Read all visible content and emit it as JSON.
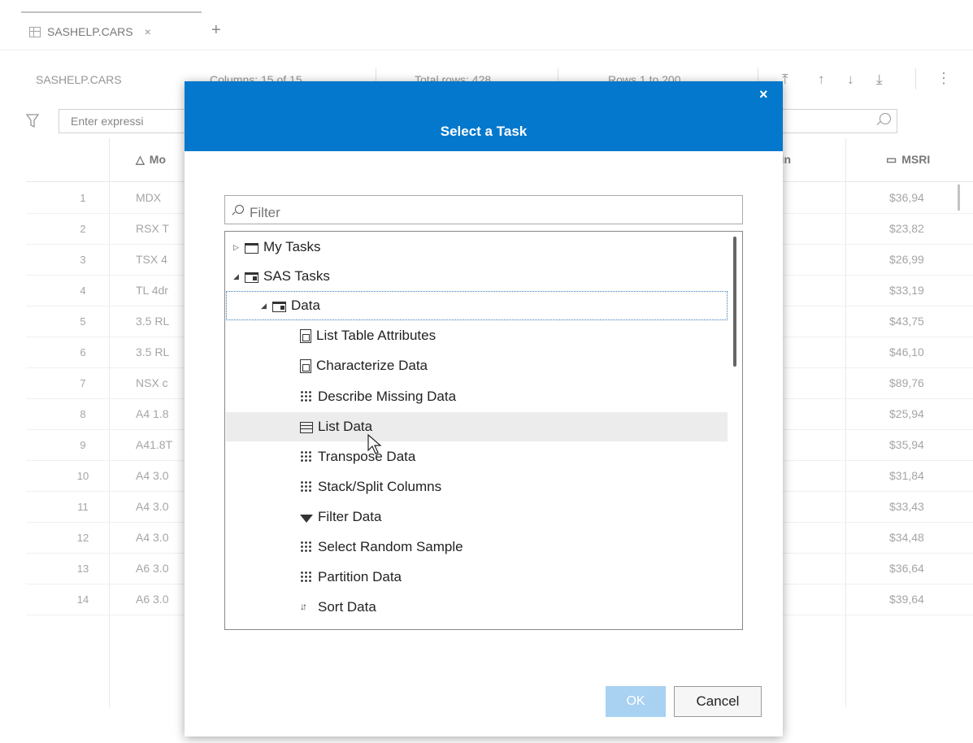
{
  "tab": {
    "title": "SASHELP.CARS",
    "close": "×",
    "add": "+"
  },
  "infobar": {
    "dataset": "SASHELP.CARS",
    "columns": "Columns: 15 of 15",
    "total_rows": "Total rows: 428",
    "rows_range": "Rows 1 to 200",
    "nav_icons": [
      "move-first-icon",
      "move-up-icon",
      "move-down-icon",
      "move-last-icon"
    ],
    "more": "⋮"
  },
  "expression": {
    "placeholder": "Enter expressi"
  },
  "grid": {
    "headers": {
      "model": "Mo",
      "origin": "gin",
      "msrp": "MSRI"
    },
    "rows": [
      {
        "n": "1",
        "model": "MDX",
        "msrp": "$36,94"
      },
      {
        "n": "2",
        "model": "RSX T",
        "msrp": "$23,82"
      },
      {
        "n": "3",
        "model": "TSX 4",
        "msrp": "$26,99"
      },
      {
        "n": "4",
        "model": "TL 4dr",
        "msrp": "$33,19"
      },
      {
        "n": "5",
        "model": "3.5 RL",
        "msrp": "$43,75"
      },
      {
        "n": "6",
        "model": "3.5 RL",
        "msrp": "$46,10"
      },
      {
        "n": "7",
        "model": "NSX c",
        "msrp": "$89,76"
      },
      {
        "n": "8",
        "model": "A4 1.8",
        "msrp": "$25,94"
      },
      {
        "n": "9",
        "model": "A41.8T",
        "msrp": "$35,94"
      },
      {
        "n": "10",
        "model": "A4 3.0",
        "msrp": "$31,84"
      },
      {
        "n": "11",
        "model": "A4 3.0",
        "msrp": "$33,43"
      },
      {
        "n": "12",
        "model": "A4 3.0",
        "msrp": "$34,48"
      },
      {
        "n": "13",
        "model": "A6 3.0",
        "msrp": "$36,64"
      },
      {
        "n": "14",
        "model": "A6 3.0",
        "msrp": "$39,64"
      }
    ]
  },
  "dialog": {
    "title": "Select a Task",
    "close": "×",
    "filter_placeholder": "Filter",
    "tree": {
      "my_tasks": "My Tasks",
      "sas_tasks": "SAS Tasks",
      "data": "Data",
      "items": [
        "List Table Attributes",
        "Characterize Data",
        "Describe Missing Data",
        "List Data",
        "Transpose Data",
        "Stack/Split Columns",
        "Filter Data",
        "Select Random Sample",
        "Partition Data",
        "Sort Data"
      ]
    },
    "ok_label": "OK",
    "cancel_label": "Cancel"
  }
}
